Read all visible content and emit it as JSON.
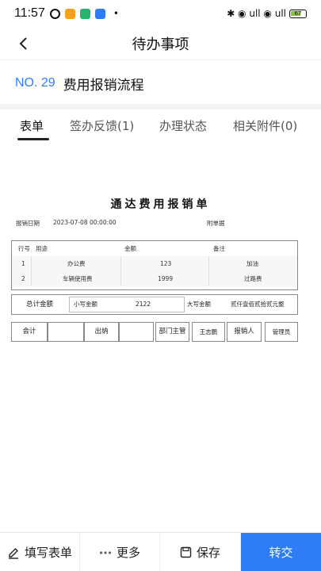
{
  "status_bar": {
    "time": "11:57",
    "dot": "•",
    "right_text": "✱ ◉ ull ◉ ull",
    "battery": "67"
  },
  "nav": {
    "back_glyph": "‹",
    "title": "待办事项"
  },
  "process": {
    "number": "NO. 29",
    "name": "费用报销流程"
  },
  "tabs": [
    {
      "label": "表单",
      "active": true
    },
    {
      "label": "签办反馈(1)",
      "active": false
    },
    {
      "label": "办理状态",
      "active": false
    },
    {
      "label": "相关附件(0)",
      "active": false
    }
  ],
  "form": {
    "title": "通达费用报销单",
    "date_label": "报销日期",
    "date_value": "2023-07-08 00:00:00",
    "attachments_label": "附单据",
    "detail": {
      "headers": [
        "行号",
        "用途",
        "金额",
        "备注"
      ],
      "rows": [
        {
          "no": "1",
          "purpose": "办公费",
          "amount": "123",
          "note": "加油"
        },
        {
          "no": "2",
          "purpose": "车辆使用费",
          "amount": "1999",
          "note": "过路费"
        }
      ]
    },
    "total": {
      "label": "总计金额",
      "small_label": "小写金额",
      "small_value": "2122",
      "big_label": "大写金额",
      "big_value": "贰仟壹佰贰拾贰元整"
    },
    "signatures": {
      "accountant_label": "会计",
      "accountant_value": "",
      "cashier_label": "出纳",
      "cashier_value": "",
      "dept_head_label": "部门主管",
      "dept_head_value": "王志鹏",
      "reporter_label": "报销人",
      "reporter_value": "管理员"
    }
  },
  "bottom_bar": {
    "fill_form": "填写表单",
    "more": "更多",
    "save": "保存",
    "transfer": "转交"
  },
  "colors": {
    "accent": "#2f7df6",
    "primary_button": "#2f7df6"
  }
}
